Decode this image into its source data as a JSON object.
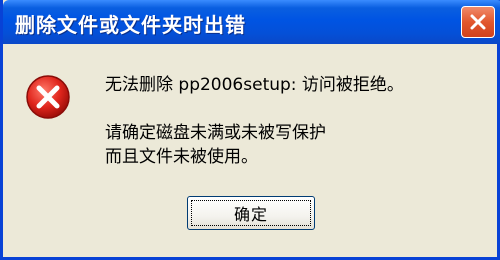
{
  "dialog": {
    "title": "删除文件或文件夹时出错",
    "icon": "error-icon",
    "message_line1": "无法删除 pp2006setup: 访问被拒绝。",
    "message_line2": "请确定磁盘未满或未被写保护",
    "message_line3": "而且文件未被使用。",
    "ok_label": "确定",
    "close_icon": "close-icon"
  },
  "colors": {
    "titlebar": "#0054e3",
    "close_button": "#e2572e",
    "error_red": "#e0261d",
    "background": "#ece9d8"
  }
}
